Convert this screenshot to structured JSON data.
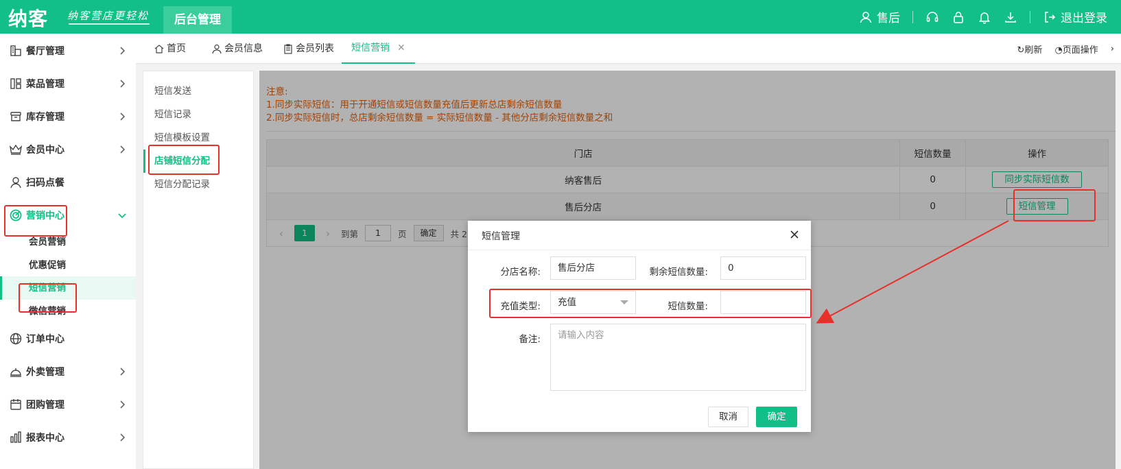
{
  "header": {
    "logo": "纳客",
    "slogan": "纳客营店更轻松",
    "admin_tab": "后台管理",
    "user": "售后",
    "logout": "退出登录"
  },
  "sidebar": {
    "items": [
      {
        "label": "餐厅管理",
        "icon": "store-icon"
      },
      {
        "label": "菜品管理",
        "icon": "dish-icon"
      },
      {
        "label": "库存管理",
        "icon": "inventory-icon"
      },
      {
        "label": "会员中心",
        "icon": "crown-icon"
      },
      {
        "label": "扫码点餐",
        "icon": "person-icon"
      },
      {
        "label": "营销中心",
        "icon": "target-icon"
      },
      {
        "label": "订单中心",
        "icon": "globe-icon"
      },
      {
        "label": "外卖管理",
        "icon": "bell-service-icon"
      },
      {
        "label": "团购管理",
        "icon": "calendar-icon"
      },
      {
        "label": "报表中心",
        "icon": "chart-icon"
      }
    ],
    "sub_items": [
      "会员营销",
      "优惠促销",
      "短信营销",
      "微信营销"
    ]
  },
  "tabs": {
    "items": [
      "首页",
      "会员信息",
      "会员列表",
      "短信营销"
    ],
    "refresh": "刷新",
    "page_ops": "页面操作"
  },
  "submenu": {
    "items": [
      "短信发送",
      "短信记录",
      "短信模板设置",
      "店铺短信分配",
      "短信分配记录"
    ]
  },
  "notice": {
    "title": "注意:",
    "line1": "1.同步实际短信：用于开通短信或短信数量充值后更新总店剩余短信数量",
    "line2": "2.同步实际短信时，总店剩余短信数量 = 实际短信数量 - 其他分店剩余短信数量之和"
  },
  "table": {
    "headers": [
      "门店",
      "短信数量",
      "操作"
    ],
    "rows": [
      {
        "store": "纳客售后",
        "count": "0",
        "action": "同步实际短信数"
      },
      {
        "store": "售后分店",
        "count": "0",
        "action": "短信管理"
      }
    ]
  },
  "pager": {
    "page": "1",
    "goto": "到第",
    "input": "1",
    "unit": "页",
    "confirm": "确定",
    "total": "共 2"
  },
  "dialog": {
    "title": "短信管理",
    "branch_label": "分店名称:",
    "branch_value": "售后分店",
    "remain_label": "剩余短信数量:",
    "remain_value": "0",
    "type_label": "充值类型:",
    "type_value": "充值",
    "count_label": "短信数量:",
    "count_value": "",
    "note_label": "备注:",
    "note_placeholder": "请输入内容",
    "cancel": "取消",
    "ok": "确定"
  },
  "colors": {
    "brand": "#12bf86",
    "warning": "#e8600a",
    "highlight": "#e8302a"
  }
}
